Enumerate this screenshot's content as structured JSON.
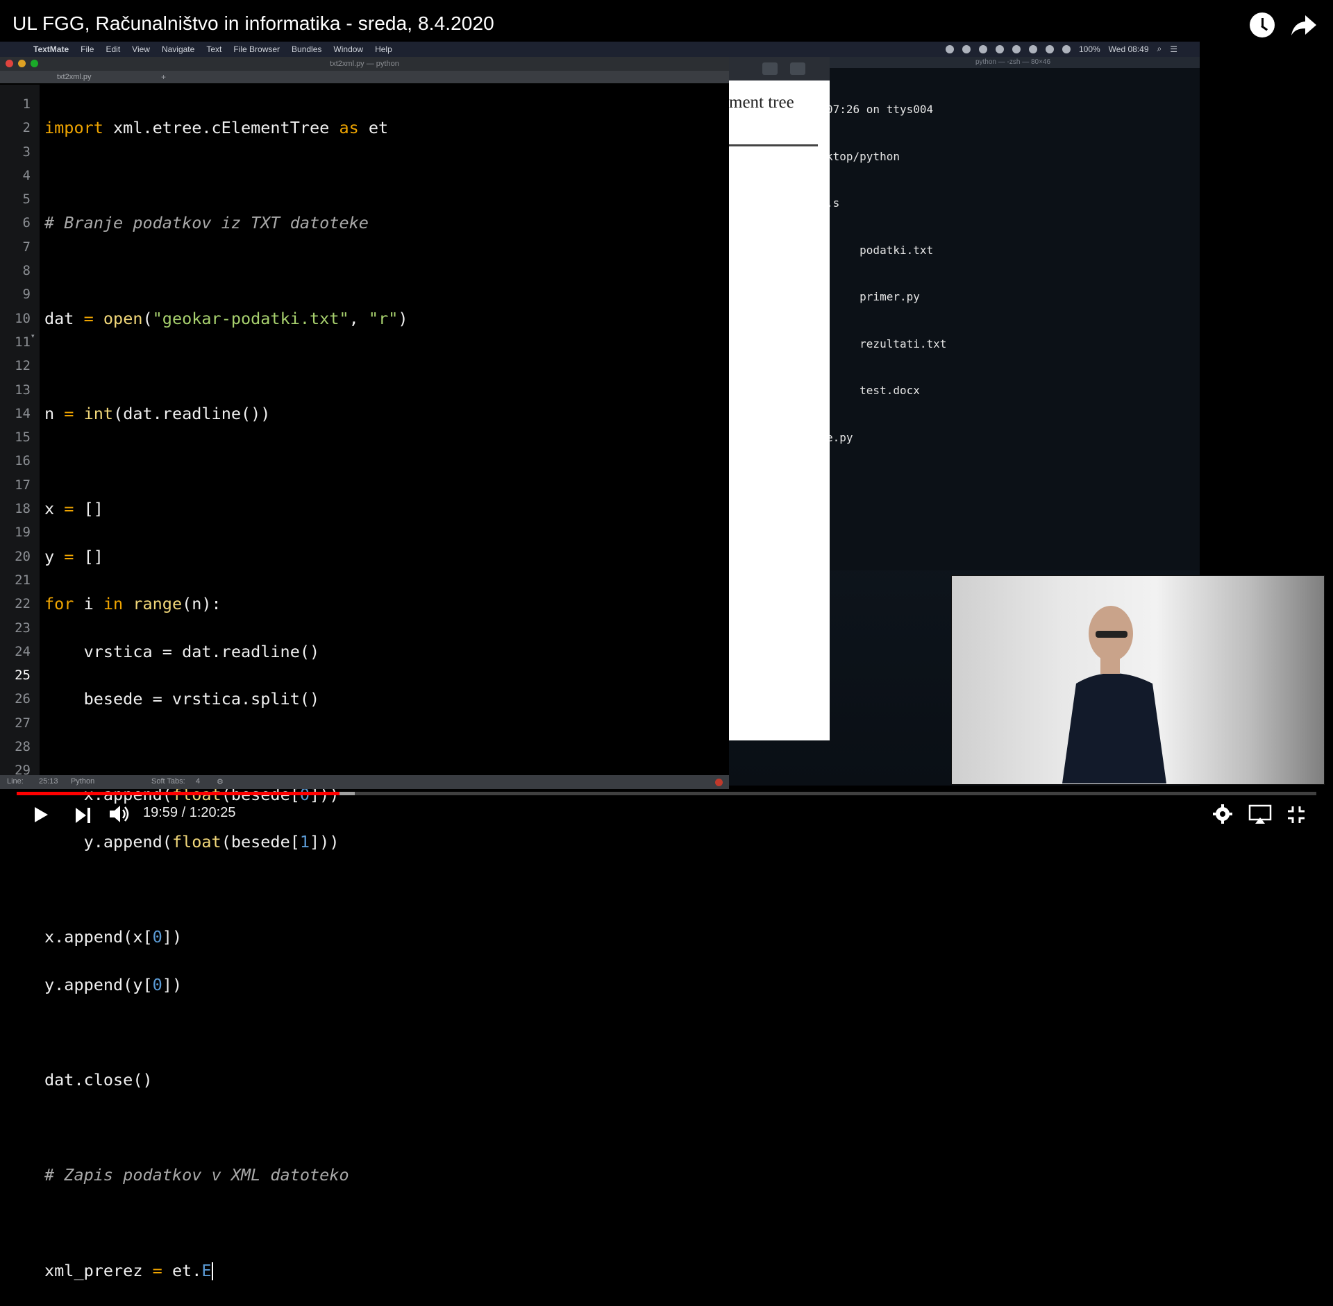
{
  "video": {
    "title": "UL FGG, Računalništvo in informatika - sreda, 8.4.2020",
    "time": {
      "current": "19:59",
      "separator": "/",
      "total": "1:20:25"
    },
    "progress_fraction": 0.2485,
    "buffer_fraction": 0.26
  },
  "menubar": {
    "items": [
      "TextMate",
      "File",
      "Edit",
      "View",
      "Navigate",
      "Text",
      "File Browser",
      "Bundles",
      "Window",
      "Help"
    ],
    "status": {
      "battery": "100%",
      "clock": "Wed 08:49"
    }
  },
  "textmate": {
    "window_title": "txt2xml.py — python",
    "tab_name": "txt2xml.py",
    "add_tab": "+",
    "line_numbers": [
      "1",
      "2",
      "3",
      "4",
      "5",
      "6",
      "7",
      "8",
      "9",
      "10",
      "11",
      "12",
      "13",
      "14",
      "15",
      "16",
      "17",
      "18",
      "19",
      "20",
      "21",
      "22",
      "23",
      "24",
      "25",
      "26",
      "27",
      "28",
      "29"
    ],
    "current_line": "25",
    "status": {
      "line_label": "Line:",
      "line_pos": "25:13",
      "language": "Python",
      "tabs": "Soft Tabs:",
      "tab_size": "4"
    }
  },
  "code_tokens": {
    "l1_import": "import",
    "l1_mod": " xml.etree.cElementTree ",
    "l1_as": "as",
    "l1_alias": " et",
    "l3_comment": "# Branje podatkov iz TXT datoteke",
    "l5_var": "dat",
    "l5_eq": " = ",
    "l5_fn": "open",
    "l5_paren": "(",
    "l5_str1": "\"geokar-podatki.txt\"",
    "l5_comma": ", ",
    "l5_str2": "\"r\"",
    "l5_close": ")",
    "l7_var": "n",
    "l7_eq": " = ",
    "l7_fn": "int",
    "l7_rest": "(dat.readline())",
    "l9_var": "x",
    "l9_eq": " = ",
    "l9_rest": "[]",
    "l10_var": "y",
    "l10_eq": " = ",
    "l10_rest": "[]",
    "l11_for": "for",
    "l11_i": " i ",
    "l11_in": "in",
    "l11_sp": " ",
    "l11_fn": "range",
    "l11_rest": "(n):",
    "l12": "    vrstica = dat.readline()",
    "l13": "    besede = vrstica.split()",
    "l15_a": "    x.append(",
    "l15_fn": "float",
    "l15_b": "(besede[",
    "l15_num": "0",
    "l15_c": "]))",
    "l16_a": "    y.append(",
    "l16_fn": "float",
    "l16_b": "(besede[",
    "l16_num": "1",
    "l16_c": "]))",
    "l18_a": "x.append(x[",
    "l18_num": "0",
    "l18_b": "])",
    "l19_a": "y.append(y[",
    "l19_num": "0",
    "l19_b": "])",
    "l21": "dat.close()",
    "l23_comment": "# Zapis podatkov v XML datoteko",
    "l25_var": "xml_prerez",
    "l25_eq": " = ",
    "l25_mod": "et.",
    "l25_typed": "E"
  },
  "browser": {
    "heading_fragment": "ment tree"
  },
  "terminal": {
    "title": "python — -zsh — 80×46",
    "lines": [
      "07:26 on ttys004",
      "ktop/python",
      ".s",
      "     podatki.txt",
      "     primer.py",
      "     rezultati.txt",
      "     test.docx",
      "e.py"
    ]
  },
  "colors": {
    "progress_played": "#ff0000",
    "keyword": "#f0a500",
    "function": "#f2d87a",
    "string": "#a8d16e",
    "number": "#5b9bd5",
    "comment": "#a9a9a9"
  },
  "icons": [
    "watch-later-icon",
    "share-icon",
    "play-icon",
    "next-icon",
    "volume-icon",
    "settings-icon",
    "airplay-icon",
    "exit-fullscreen-icon",
    "apple-icon"
  ]
}
